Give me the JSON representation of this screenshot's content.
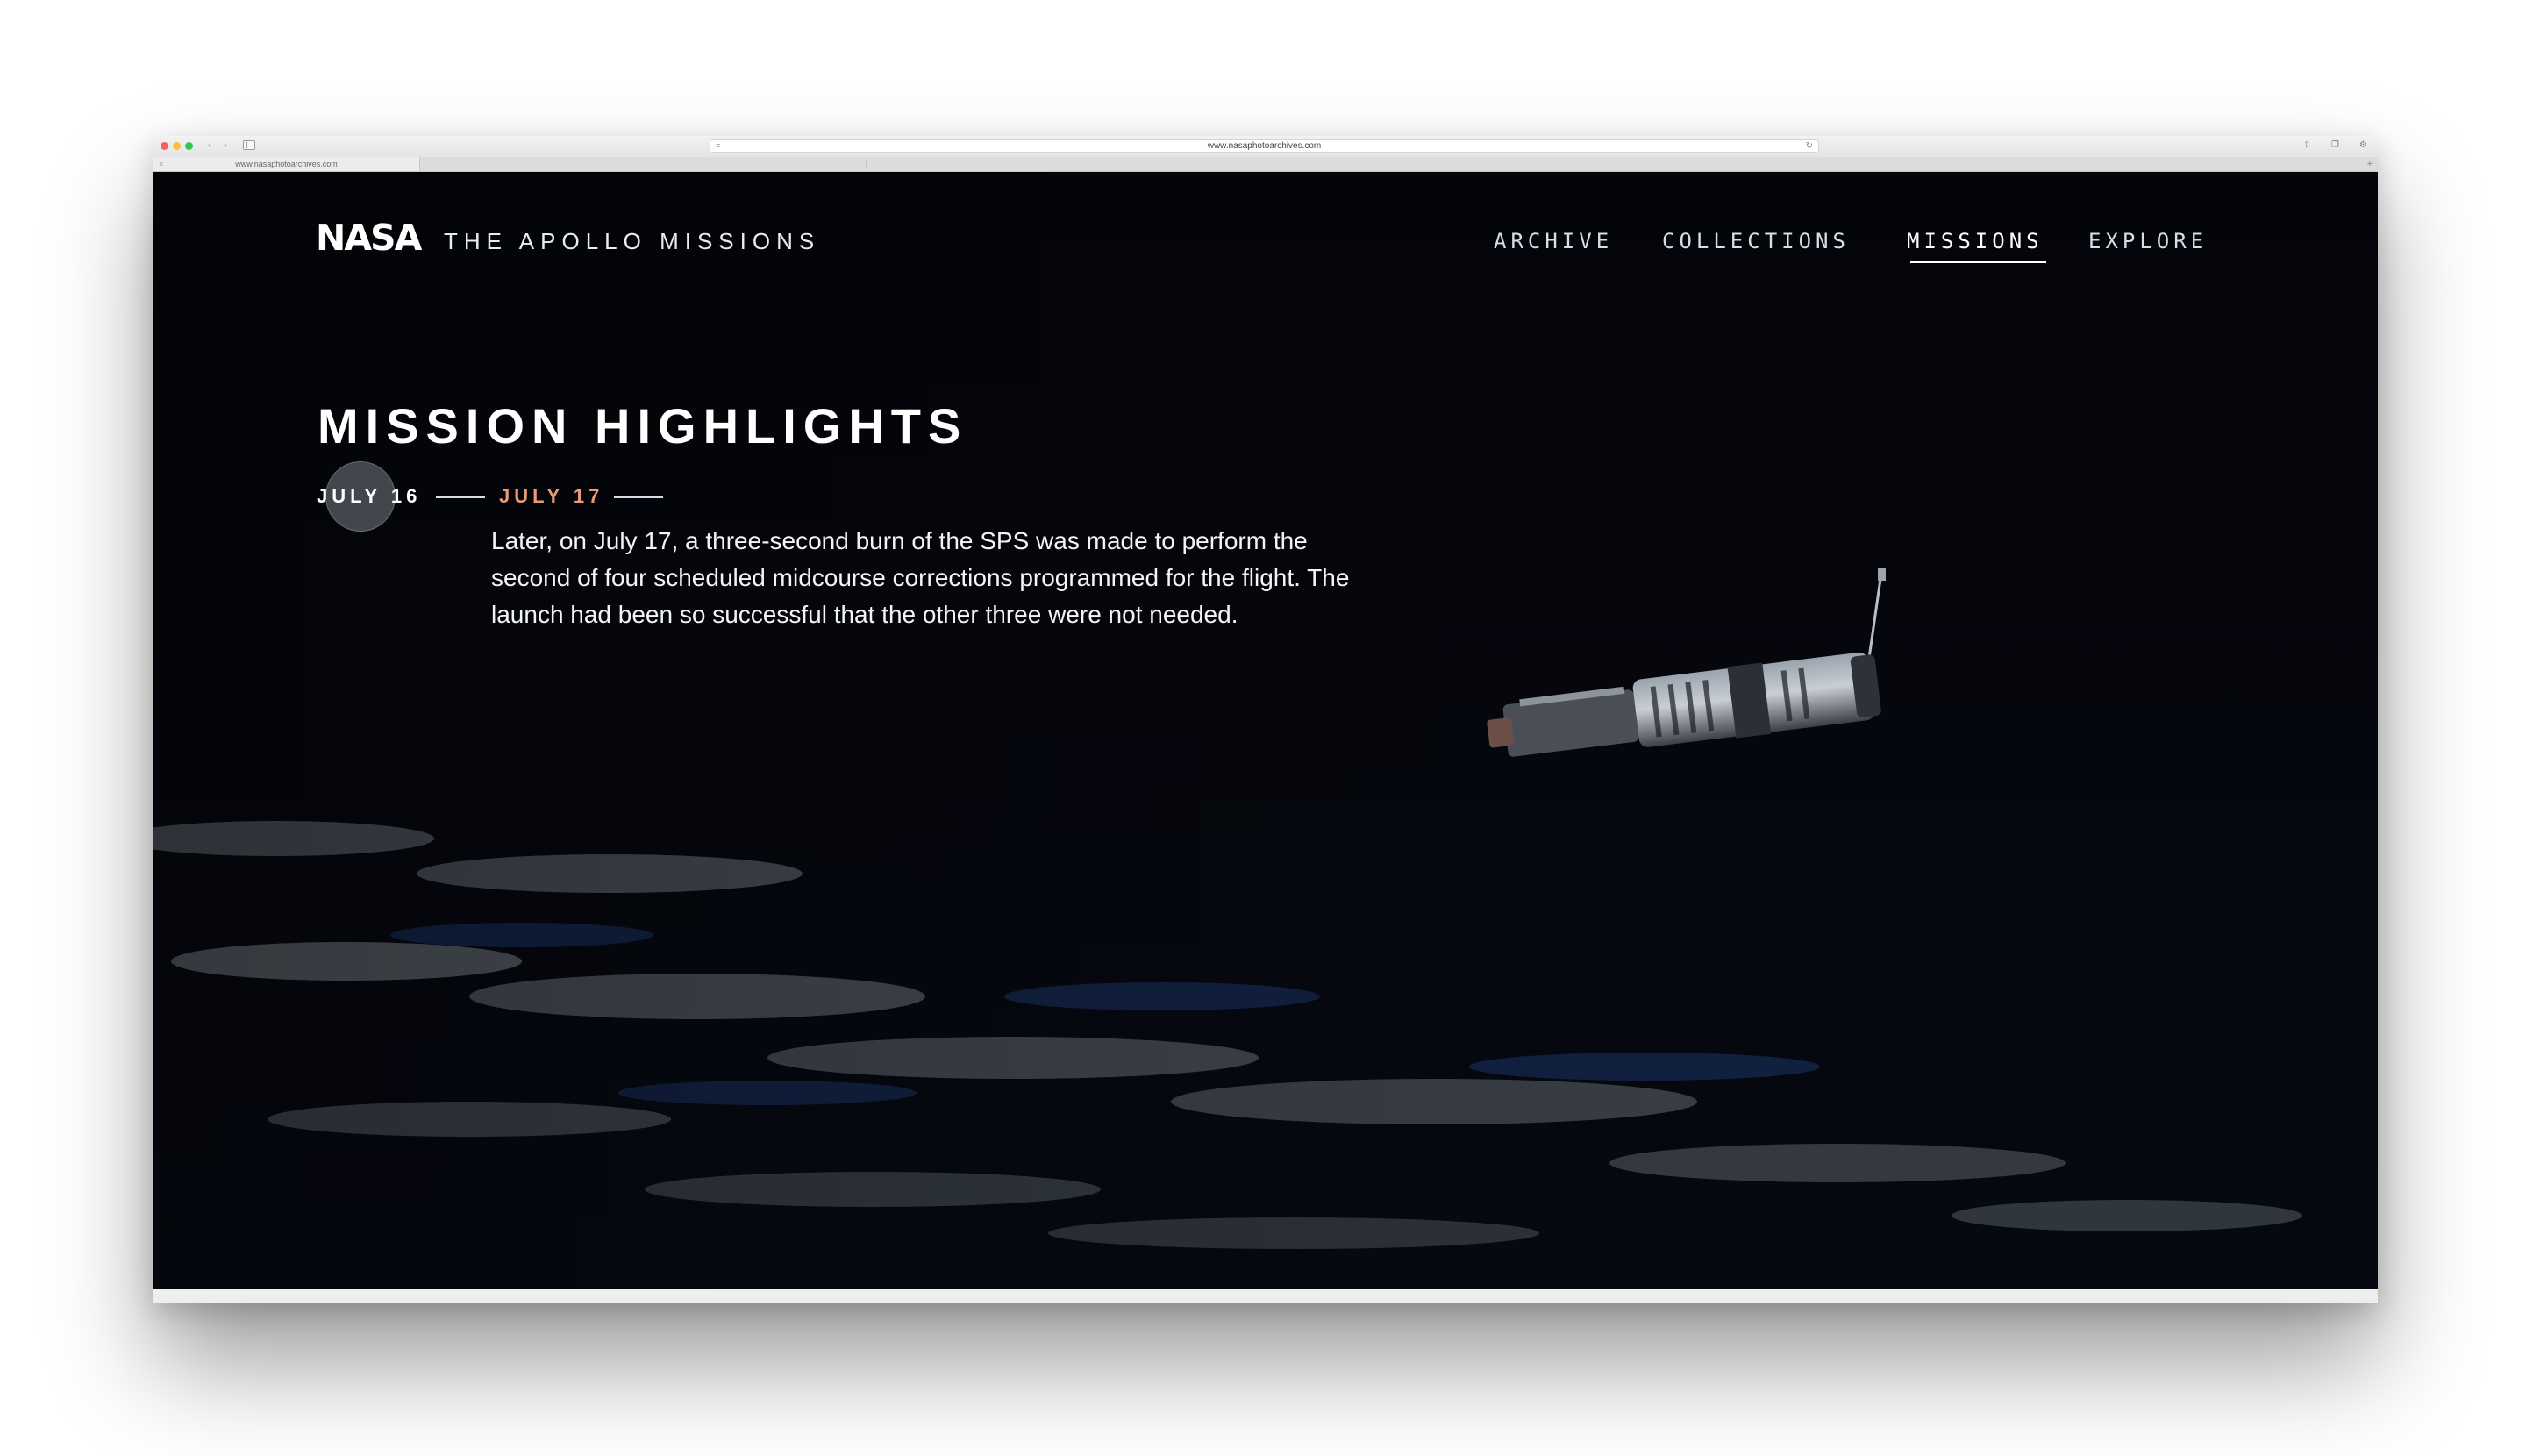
{
  "browser": {
    "url": "www.nasaphotoarchives.com",
    "tab_title": "www.nasaphotoarchives.com"
  },
  "header": {
    "logo_text": "NASA",
    "site_title": "THE APOLLO MISSIONS",
    "nav": {
      "archive": "ARCHIVE",
      "collections": "COLLECTIONS",
      "missions": "MISSIONS",
      "explore": "EXPLORE"
    },
    "active_nav": "MISSIONS"
  },
  "hero": {
    "title": "MISSION HIGHLIGHTS",
    "timeline": {
      "previous": "JULY 16",
      "current": "JULY 17"
    },
    "body": "Later, on July 17, a three-second burn of the SPS was made to perform the second of four scheduled midcourse corrections programmed for the flight. The launch had been so successful that the other three were not needed."
  },
  "colors": {
    "accent": "#e89a75",
    "text": "#ffffff",
    "background": "#05070d"
  },
  "icons": {
    "back": "chevron-left-icon",
    "forward": "chevron-right-icon",
    "sidebar": "sidebar-icon",
    "reload": "reload-icon",
    "share": "share-icon",
    "tabs": "tabs-icon",
    "close_tab": "close-icon"
  }
}
